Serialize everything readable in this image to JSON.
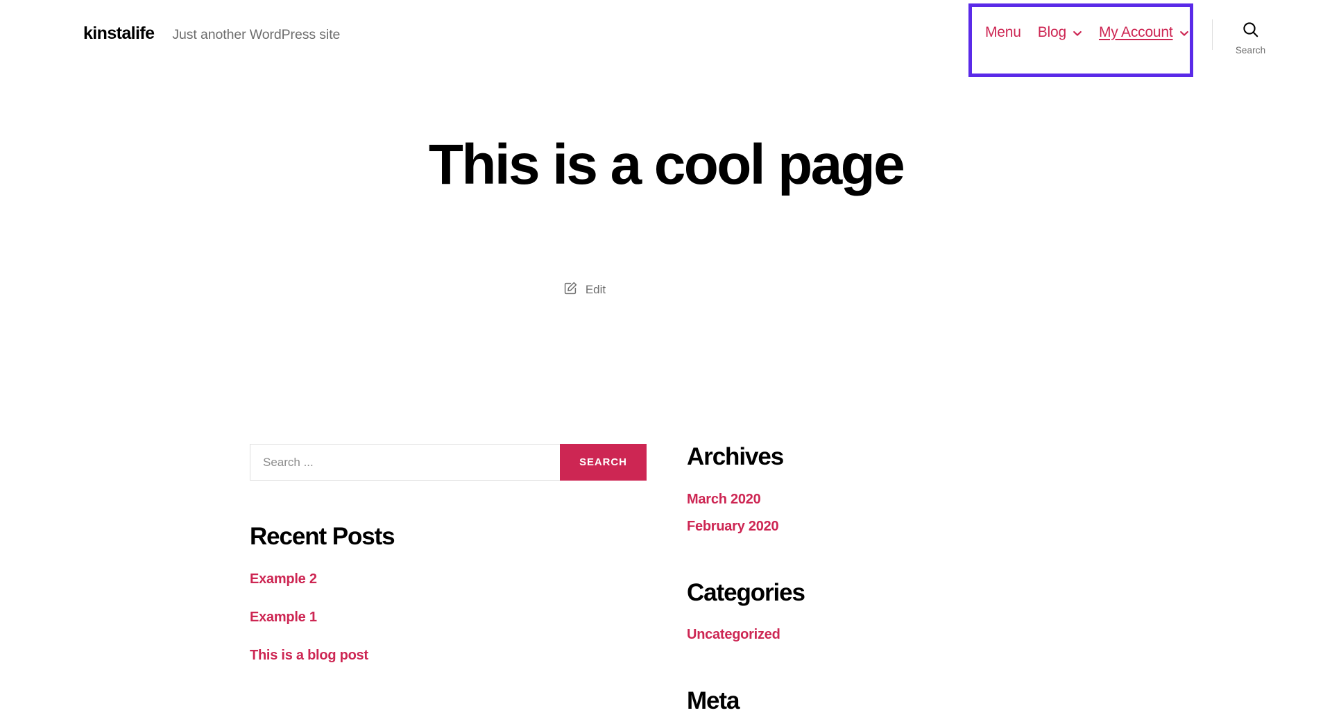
{
  "header": {
    "site_title": "kinstalife",
    "site_description": "Just another WordPress site",
    "nav": [
      {
        "label": "Menu",
        "has_dropdown": false,
        "current": false,
        "icon": ""
      },
      {
        "label": "Blog",
        "has_dropdown": true,
        "current": false,
        "icon": "chevron-down-icon"
      },
      {
        "label": "My Account",
        "has_dropdown": true,
        "current": true,
        "icon": "chevron-down-icon"
      }
    ],
    "search_toggle_label": "Search",
    "search_toggle_icon": "search-icon",
    "highlight_color": "#5a2ae8"
  },
  "page": {
    "title": "This is a cool page",
    "edit_label": "Edit",
    "edit_icon": "edit-pencil-icon"
  },
  "widgets": {
    "search": {
      "placeholder": "Search ...",
      "value": "",
      "submit_label": "SEARCH"
    },
    "recent_posts": {
      "title": "Recent Posts",
      "items": [
        {
          "label": "Example 2"
        },
        {
          "label": "Example 1"
        },
        {
          "label": "This is a blog post"
        }
      ]
    },
    "archives": {
      "title": "Archives",
      "items": [
        {
          "label": "March 2020"
        },
        {
          "label": "February 2020"
        }
      ]
    },
    "categories": {
      "title": "Categories",
      "items": [
        {
          "label": "Uncategorized"
        }
      ]
    },
    "meta": {
      "title": "Meta"
    }
  },
  "colors": {
    "accent": "#cd2653",
    "text": "#000000",
    "muted": "#6d6d6d",
    "highlight": "#5a2ae8",
    "border": "#dedede"
  }
}
